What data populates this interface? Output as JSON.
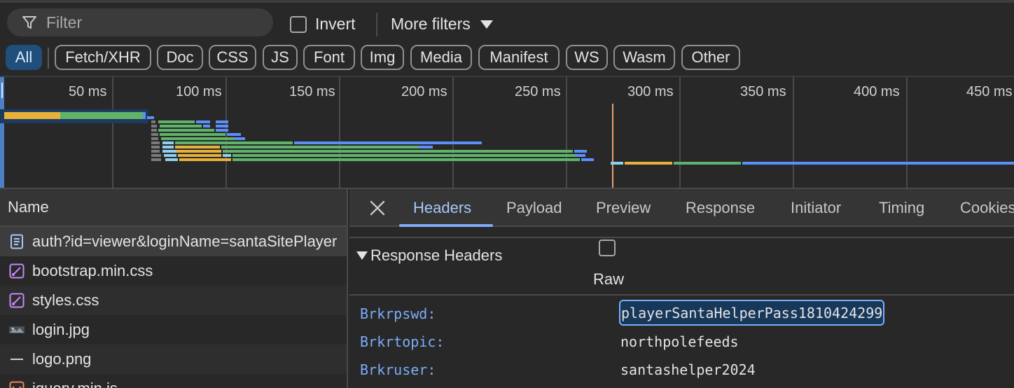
{
  "filter_bar": {
    "filter_placeholder": "Filter",
    "invert_label": "Invert",
    "more_filters_label": "More filters",
    "type_filters": [
      "All",
      "Fetch/XHR",
      "Doc",
      "CSS",
      "JS",
      "Font",
      "Img",
      "Media",
      "Manifest",
      "WS",
      "Wasm",
      "Other"
    ],
    "active_type": "All"
  },
  "overview": {
    "ticks": [
      "50 ms",
      "100 ms",
      "150 ms",
      "200 ms",
      "250 ms",
      "300 ms",
      "350 ms",
      "400 ms",
      "450 ms"
    ]
  },
  "request_list": {
    "column_header": "Name",
    "rows": [
      {
        "name": "auth?id=viewer&loginName=santaSitePlayer",
        "icon": "document-icon"
      },
      {
        "name": "bootstrap.min.css",
        "icon": "stylesheet-icon"
      },
      {
        "name": "styles.css",
        "icon": "stylesheet-icon"
      },
      {
        "name": "login.jpg",
        "icon": "image-thumbnail-icon"
      },
      {
        "name": "logo.png",
        "icon": "image-placeholder-icon"
      },
      {
        "name": "jquery.min.js",
        "icon": "script-icon"
      }
    ]
  },
  "details": {
    "tabs": [
      "Headers",
      "Payload",
      "Preview",
      "Response",
      "Initiator",
      "Timing",
      "Cookies"
    ],
    "active_tab": "Headers",
    "section_title": "Response Headers",
    "raw_label": "Raw",
    "headers": [
      {
        "key": "Brkrpswd:",
        "value": "playerSantaHelperPass1810424299"
      },
      {
        "key": "Brkrtopic:",
        "value": "northpolefeeds"
      },
      {
        "key": "Brkruser:",
        "value": "santashelper2024"
      }
    ]
  },
  "colors": {
    "background": "#282828",
    "accent": "#7cacf8",
    "active_chip": "#1f4f7a",
    "waterfall_waiting": "#e6b23a",
    "waterfall_download": "#5fb36a",
    "waterfall_blue": "#5b8ff9",
    "waterfall_light": "#8fd0f0",
    "load_marker": "#e8a070"
  }
}
